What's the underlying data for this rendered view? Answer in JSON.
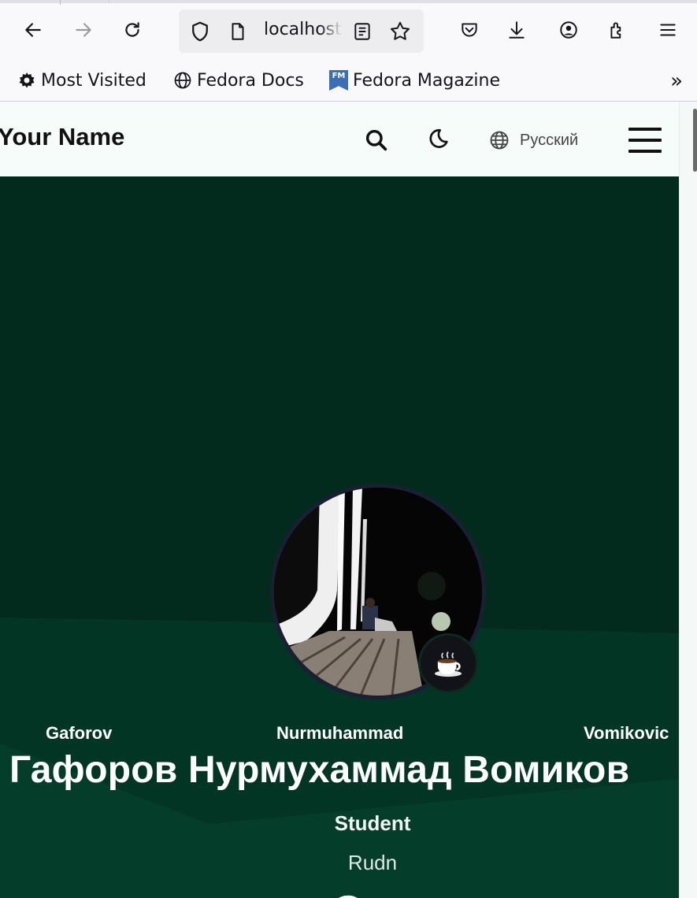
{
  "browser": {
    "url_text": "localhost",
    "bookmarks": [
      {
        "label": "Most Visited",
        "icon": "gear-icon"
      },
      {
        "label": "Fedora Docs",
        "icon": "globe-icon"
      },
      {
        "label": "Fedora Magazine",
        "icon": "fedora-magazine-icon",
        "badge": "FM"
      }
    ],
    "overflow_label": "»"
  },
  "site": {
    "brand": "Your Name",
    "language": "Русский",
    "icons": [
      "search-icon",
      "moon-icon",
      "globe-icon",
      "hamburger-menu-icon"
    ]
  },
  "profile": {
    "name_parts": [
      "Gaforov",
      "Nurmuhammad",
      "Vomikovic"
    ],
    "full_name": "Гафоров Нурмухаммад Вомиков",
    "role": "Student",
    "organization": "Rudn",
    "status_icon": "coffee-icon",
    "social_icons": [
      "github-icon",
      "google-scholar-icon"
    ]
  },
  "colors": {
    "hero_bg": "#022b1d",
    "hero_wave": "#053d2b",
    "nav_bg": "#f6fcfa",
    "fedora_blue": "#3c6eb4"
  }
}
